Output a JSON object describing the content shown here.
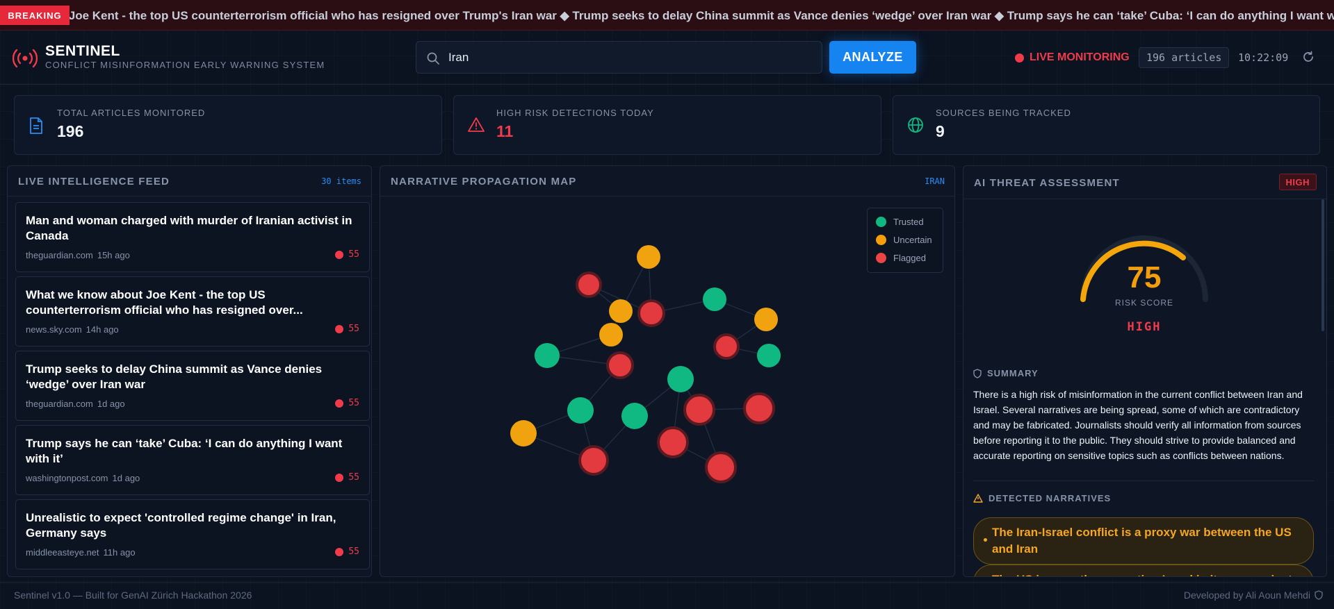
{
  "ticker": {
    "badge": "BREAKING",
    "text": "ut Joe Kent - the top US counterterrorism official who has resigned over Trump's Iran war ◆ Trump seeks to delay China summit as Vance denies ‘wedge’ over Iran war ◆ Trump says he can ‘take’ Cuba: ‘I can do anything I want with it’"
  },
  "header": {
    "brand_title": "SENTINEL",
    "brand_subtitle": "CONFLICT MISINFORMATION EARLY WARNING SYSTEM",
    "search_value": "Iran",
    "analyze_label": "ANALYZE",
    "live_label": "LIVE MONITORING",
    "article_count": "196 articles",
    "clock": "10:22:09"
  },
  "stats": [
    {
      "label": "TOTAL ARTICLES MONITORED",
      "value": "196",
      "icon": "document-icon"
    },
    {
      "label": "HIGH RISK DETECTIONS TODAY",
      "value": "11",
      "icon": "warning-icon"
    },
    {
      "label": "SOURCES BEING TRACKED",
      "value": "9",
      "icon": "globe-icon"
    }
  ],
  "feed": {
    "title": "LIVE INTELLIGENCE FEED",
    "count": "30 items",
    "items": [
      {
        "title": "Man and woman charged with murder of Iranian activist in Canada",
        "source": "theguardian.com",
        "age": "15h ago",
        "score": "55"
      },
      {
        "title": "What we know about Joe Kent - the top US counterterrorism official who has resigned over...",
        "source": "news.sky.com",
        "age": "14h ago",
        "score": "55"
      },
      {
        "title": "Trump seeks to delay China summit as Vance denies ‘wedge’ over Iran war",
        "source": "theguardian.com",
        "age": "1d ago",
        "score": "55"
      },
      {
        "title": "Trump says he can ‘take’ Cuba: ‘I can do anything I want with it’",
        "source": "washingtonpost.com",
        "age": "1d ago",
        "score": "55"
      },
      {
        "title": "Unrealistic to expect 'controlled regime change' in Iran, Germany says",
        "source": "middleeasteye.net",
        "age": "11h ago",
        "score": "55"
      }
    ]
  },
  "map": {
    "title": "NARRATIVE PROPAGATION MAP",
    "tag": "IRAN",
    "legend": [
      {
        "label": "Trusted",
        "color": "#10b981"
      },
      {
        "label": "Uncertain",
        "color": "#f59e0b"
      },
      {
        "label": "Flagged",
        "color": "#ef4444"
      }
    ]
  },
  "assessment": {
    "title": "AI THREAT ASSESSMENT",
    "badge": "HIGH",
    "risk_score": "75",
    "risk_score_label": "RISK SCORE",
    "risk_level": "HIGH",
    "summary_heading": "SUMMARY",
    "summary": "There is a high risk of misinformation in the current conflict between Iran and Israel. Several narratives are being spread, some of which are contradictory and may be fabricated. Journalists should verify all information from sources before reporting it to the public. They should strive to provide balanced and accurate reporting on sensitive topics such as conflicts between nations.",
    "narratives_heading": "DETECTED NARRATIVES",
    "narratives": [
      "The Iran-Israel conflict is a proxy war between the US and Iran",
      "The US is secretly supporting Israel in its war against Iran"
    ]
  },
  "footer": {
    "left": "Sentinel v1.0 — Built for GenAI Zürich Hackathon 2026",
    "right": "Developed by Ali Aoun Mehdi"
  },
  "colors": {
    "accent": "#1583f0",
    "danger": "#ef3b4a",
    "warning": "#f59e0b",
    "success": "#10b981"
  }
}
